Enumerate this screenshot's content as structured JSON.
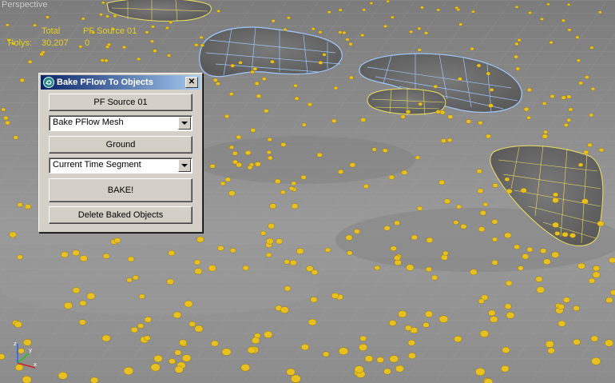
{
  "viewport": {
    "label": "Perspective",
    "stats": {
      "total_label": "Total",
      "source_label": "PF Source 01",
      "polys_label": "Polys:",
      "polys_value": "30,207",
      "polys_extra": "0"
    },
    "colors": {
      "particle": "#e8c020",
      "wire_yellow": "#f0e060",
      "wire_blue": "#a0c8ff",
      "ground": "#8e8e8e"
    }
  },
  "dialog": {
    "title": "Bake PFlow To Objects",
    "source_button": "PF Source 01",
    "mesh_dropdown": {
      "selected": "Bake PFlow Mesh"
    },
    "ground_button": "Ground",
    "time_dropdown": {
      "selected": "Current Time Segment"
    },
    "bake_button": "BAKE!",
    "delete_button": "Delete Baked Objects",
    "close_label": "✕"
  }
}
